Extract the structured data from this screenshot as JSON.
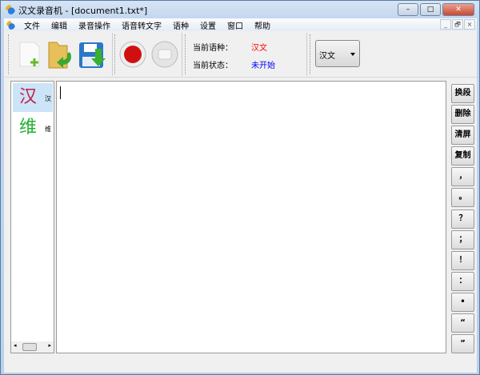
{
  "window": {
    "title": "汉文录音机 - [document1.txt*]",
    "min": "–",
    "max": "□",
    "close": "✕"
  },
  "menu": [
    "文件",
    "编辑",
    "录音操作",
    "语音转文字",
    "语种",
    "设置",
    "窗口",
    "帮助"
  ],
  "mdi": {
    "min": "_",
    "restore": "🗗",
    "close": "×"
  },
  "toolbar": {
    "icons": [
      "new-file-icon",
      "open-folder-icon",
      "save-icon",
      "record-icon",
      "stop-icon"
    ],
    "lang_label": "当前语种：",
    "lang_value": "汉文",
    "lang_color": "#ff0000",
    "status_label": "当前状态：",
    "status_value": "未开始",
    "status_color": "#0000ff",
    "combo_value": "汉文"
  },
  "languages": [
    {
      "glyph": "汉",
      "label": "汉",
      "color": "#c0204a",
      "selected": true
    },
    {
      "glyph": "维",
      "label": "维",
      "color": "#20b030",
      "selected": false
    }
  ],
  "right_buttons": [
    "换段",
    "删除",
    "清屏",
    "复制",
    "，",
    "。",
    "？",
    "；",
    "！",
    "：",
    "•",
    "“",
    "”"
  ],
  "more": "»"
}
